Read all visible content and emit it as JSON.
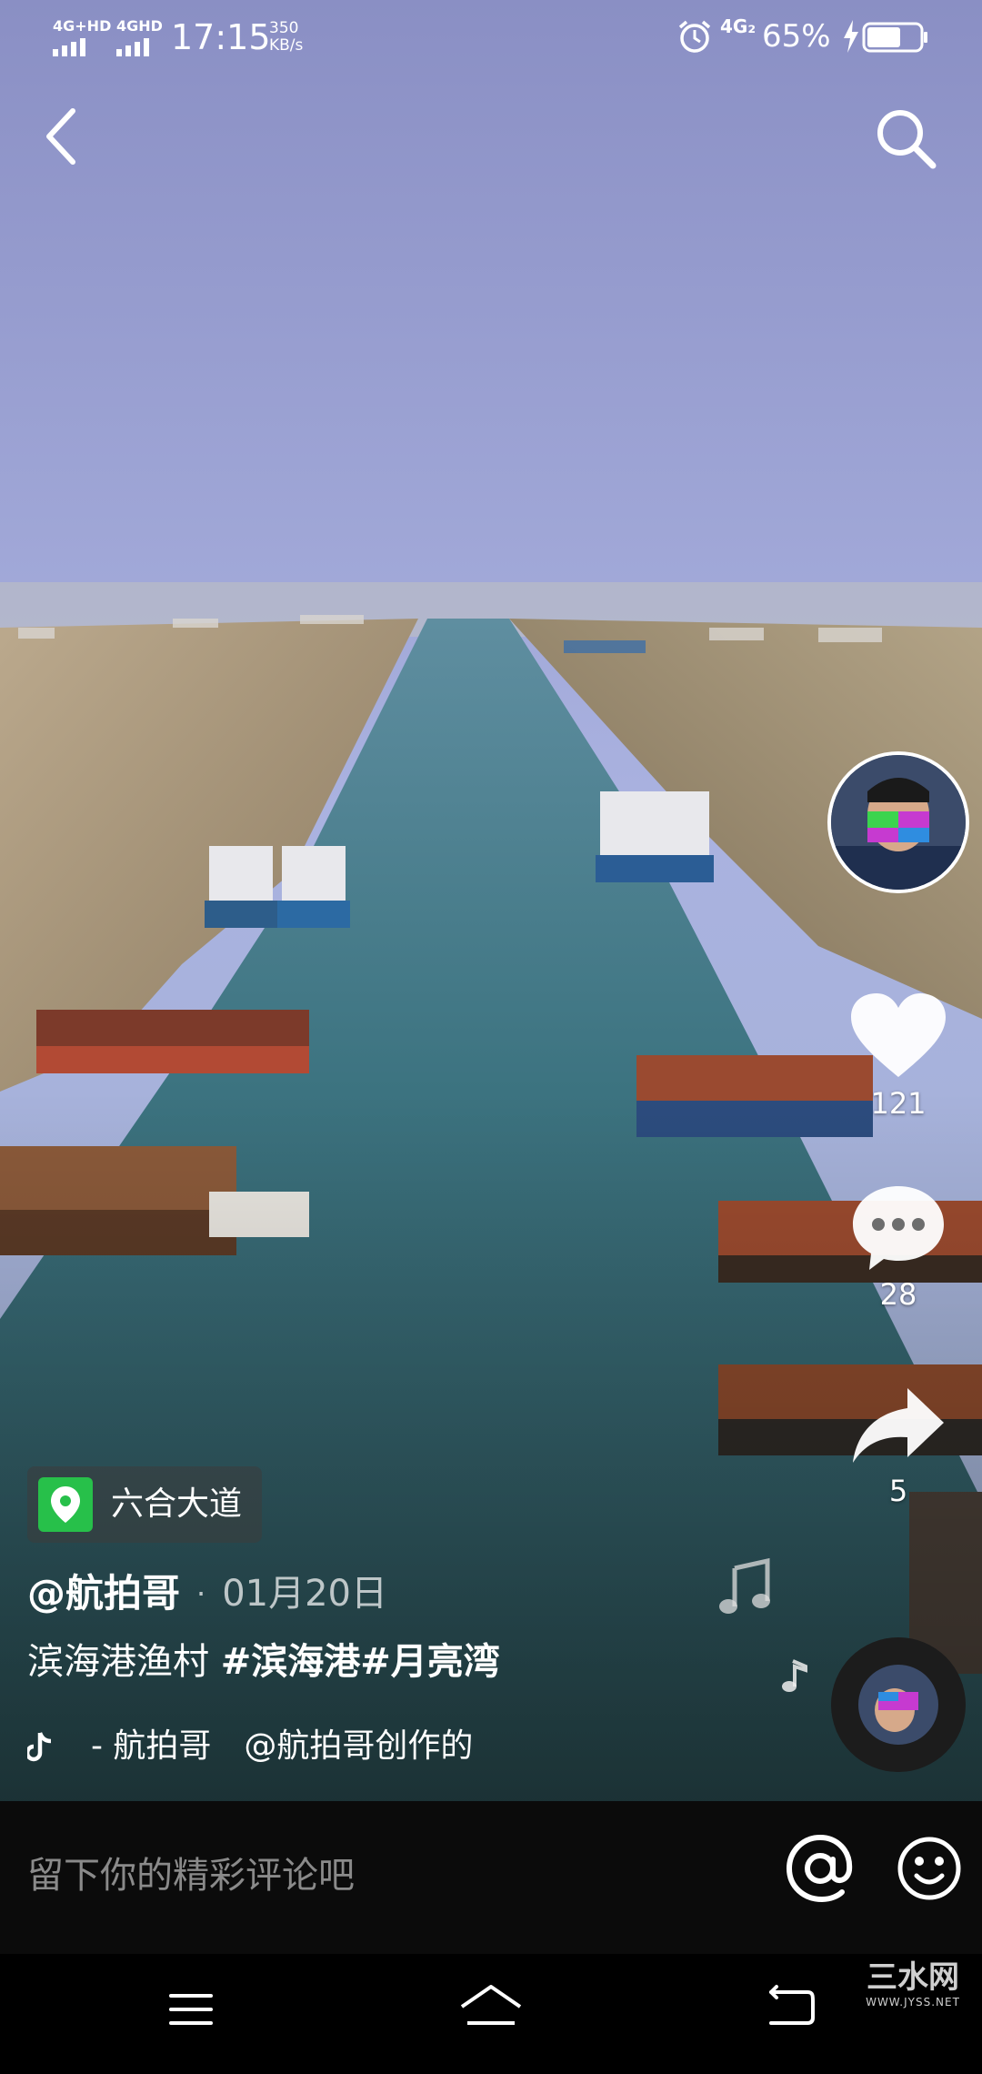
{
  "status_bar": {
    "network_1": "4G+HD",
    "network_2": "4GHD",
    "time": "17:15",
    "speed_value": "350",
    "speed_unit": "KB/s",
    "network_3": "4G₂",
    "battery": "65%"
  },
  "video": {
    "location": "六合大道",
    "author": "@航拍哥",
    "date": "01月20日",
    "caption_text": "滨海港渔村 ",
    "caption_tags": "#滨海港#月亮湾",
    "music": "- 航拍哥　@航拍哥创作的"
  },
  "actions": {
    "likes": "121",
    "comments": "28",
    "shares": "5"
  },
  "comment_bar": {
    "placeholder": "留下你的精彩评论吧"
  },
  "watermark": {
    "main": "三水网",
    "sub": "WWW.JYSS.NET"
  },
  "icons": {
    "back": "back-arrow-icon",
    "search": "search-icon",
    "like": "heart-icon",
    "comment": "comment-bubble-icon",
    "share": "share-arrow-icon",
    "location": "location-pin-icon",
    "at": "at-sign-icon",
    "emoji": "emoji-icon"
  },
  "colors": {
    "location_pin": "#27c04a",
    "sky_top": "#8d93c9",
    "water": "#39656a"
  }
}
